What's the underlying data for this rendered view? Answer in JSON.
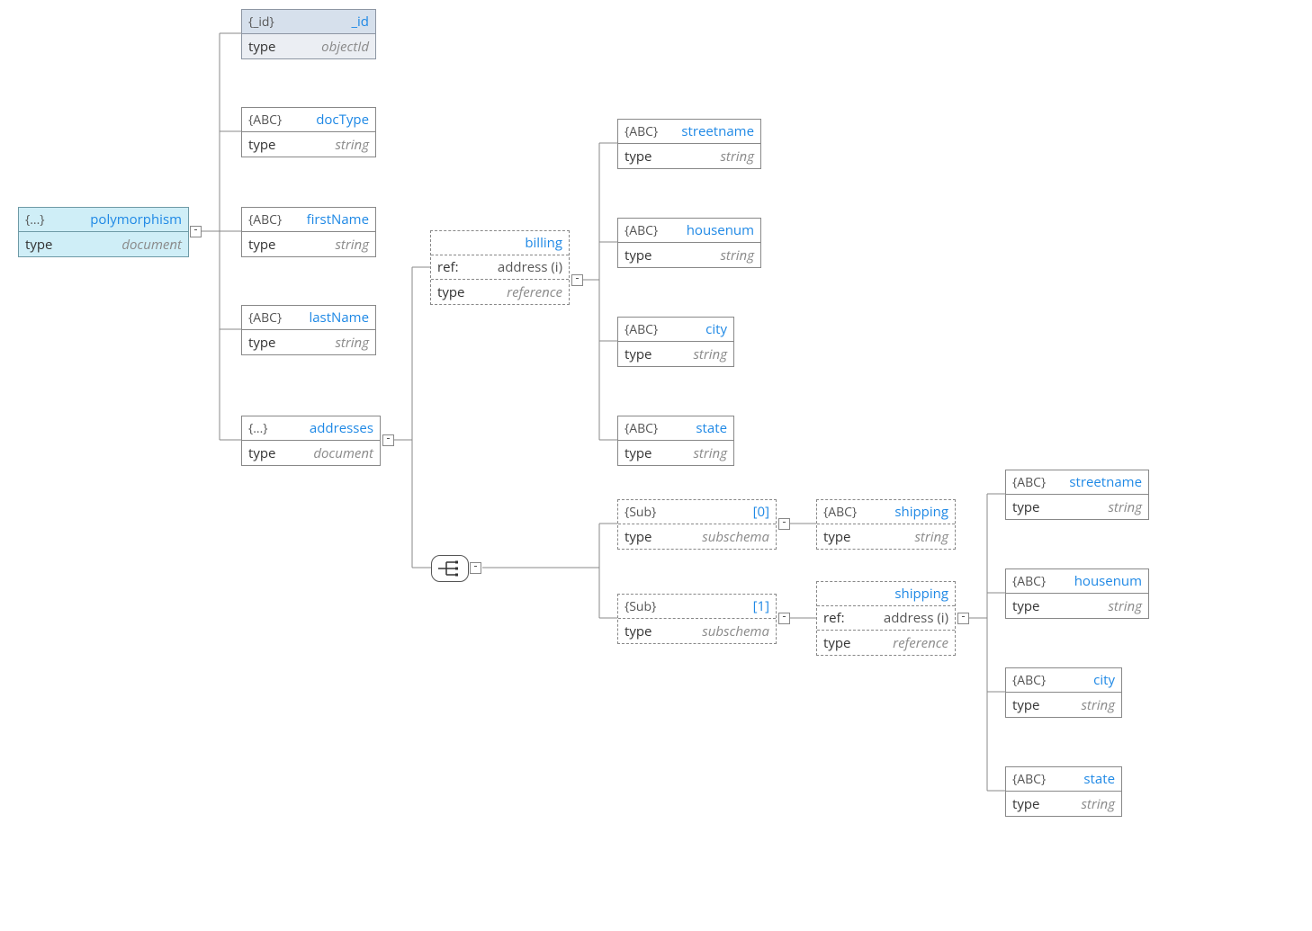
{
  "labels": {
    "type": "type",
    "ref": "ref:"
  },
  "kinds": {
    "doc": "{...}",
    "abc": "{ABC}",
    "id": "{_id}",
    "sub": "{Sub}"
  },
  "types": {
    "document": "document",
    "objectId": "objectId",
    "string": "string",
    "reference": "reference",
    "subschema": "subschema"
  },
  "nodes": {
    "root": {
      "name": "polymorphism",
      "type": "document"
    },
    "id": {
      "name": "_id",
      "type": "objectId"
    },
    "docType": {
      "name": "docType",
      "type": "string"
    },
    "firstName": {
      "name": "firstName",
      "type": "string"
    },
    "lastName": {
      "name": "lastName",
      "type": "string"
    },
    "addresses": {
      "name": "addresses",
      "type": "document"
    },
    "billing": {
      "name": "billing",
      "ref": "address (i)",
      "type": "reference"
    },
    "sub0": {
      "name": "[0]",
      "type": "subschema"
    },
    "sub1": {
      "name": "[1]",
      "type": "subschema"
    },
    "shippingA": {
      "name": "shipping",
      "type": "string"
    },
    "shippingB": {
      "name": "shipping",
      "ref": "address (i)",
      "type": "reference"
    },
    "bill_street": {
      "name": "streetname",
      "type": "string"
    },
    "bill_house": {
      "name": "housenum",
      "type": "string"
    },
    "bill_city": {
      "name": "city",
      "type": "string"
    },
    "bill_state": {
      "name": "state",
      "type": "string"
    },
    "ship_street": {
      "name": "streetname",
      "type": "string"
    },
    "ship_house": {
      "name": "housenum",
      "type": "string"
    },
    "ship_city": {
      "name": "city",
      "type": "string"
    },
    "ship_state": {
      "name": "state",
      "type": "string"
    }
  }
}
